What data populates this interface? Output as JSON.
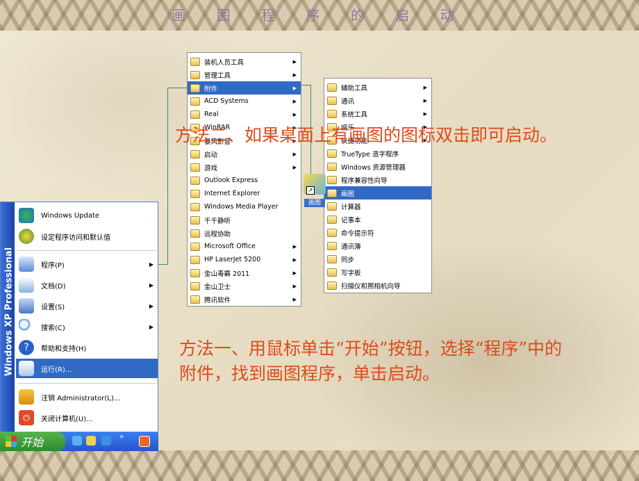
{
  "title": "画 图 程 序 的 启 动",
  "xp_label": "Windows XP Professional",
  "start_menu": {
    "items": [
      {
        "label": "Windows Update",
        "icon": "windows-update-icon"
      },
      {
        "label": "设定程序访问和默认值",
        "icon": "program-defaults-icon"
      },
      {
        "label": "程序(P)",
        "icon": "programs-icon",
        "arrow": true
      },
      {
        "label": "文档(D)",
        "icon": "documents-icon",
        "arrow": true
      },
      {
        "label": "设置(S)",
        "icon": "settings-icon",
        "arrow": true
      },
      {
        "label": "搜索(C)",
        "icon": "search-icon",
        "arrow": true
      },
      {
        "label": "帮助和支持(H)",
        "icon": "help-icon"
      },
      {
        "label": "运行(R)...",
        "icon": "run-icon",
        "highlighted": true
      },
      {
        "label": "注销 Administrator(L)...",
        "icon": "logoff-icon"
      },
      {
        "label": "关闭计算机(U)...",
        "icon": "shutdown-icon"
      }
    ]
  },
  "taskbar": {
    "start_label": "开始"
  },
  "programs_menu": {
    "items": [
      {
        "label": "装机人员工具",
        "arrow": true
      },
      {
        "label": "管理工具",
        "arrow": true
      },
      {
        "label": "附件",
        "arrow": true,
        "highlighted": true
      },
      {
        "label": "ACD Systems",
        "arrow": true
      },
      {
        "label": "Real",
        "arrow": true
      },
      {
        "label": "WinRAR",
        "arrow": true
      },
      {
        "label": "暴风影音",
        "arrow": true
      },
      {
        "label": "启动",
        "arrow": true
      },
      {
        "label": "游戏",
        "arrow": true
      },
      {
        "label": "Outlook Express"
      },
      {
        "label": "Internet Explorer"
      },
      {
        "label": "Windows Media Player"
      },
      {
        "label": "千千静听"
      },
      {
        "label": "远程协助"
      },
      {
        "label": "Microsoft Office",
        "arrow": true
      },
      {
        "label": "HP LaserJet 5200",
        "arrow": true
      },
      {
        "label": "金山毒霸 2011",
        "arrow": true
      },
      {
        "label": "金山卫士",
        "arrow": true
      },
      {
        "label": "腾讯软件",
        "arrow": true
      }
    ]
  },
  "accessories_menu": {
    "items": [
      {
        "label": "辅助工具",
        "arrow": true
      },
      {
        "label": "通讯",
        "arrow": true
      },
      {
        "label": "系统工具",
        "arrow": true
      },
      {
        "label": "娱乐",
        "arrow": true
      },
      {
        "label": "快捷功能",
        "arrow": true
      },
      {
        "label": "TrueType 造字程序"
      },
      {
        "label": "Windows 资源管理器"
      },
      {
        "label": "程序兼容性向导"
      },
      {
        "label": "画图",
        "highlighted": true
      },
      {
        "label": "计算器"
      },
      {
        "label": "记事本"
      },
      {
        "label": "命令提示符"
      },
      {
        "label": "通讯簿"
      },
      {
        "label": "同步"
      },
      {
        "label": "写字板"
      },
      {
        "label": "扫描仪和照相机向导"
      }
    ]
  },
  "desktop_icon": {
    "label": "画图"
  },
  "method2_text": "方法二、如果桌面上有画图的图标双击即可启动。",
  "method1_text": "方法一、用鼠标单击“开始”按钮，选择“程序”中的附件，找到画图程序，单击启动。"
}
